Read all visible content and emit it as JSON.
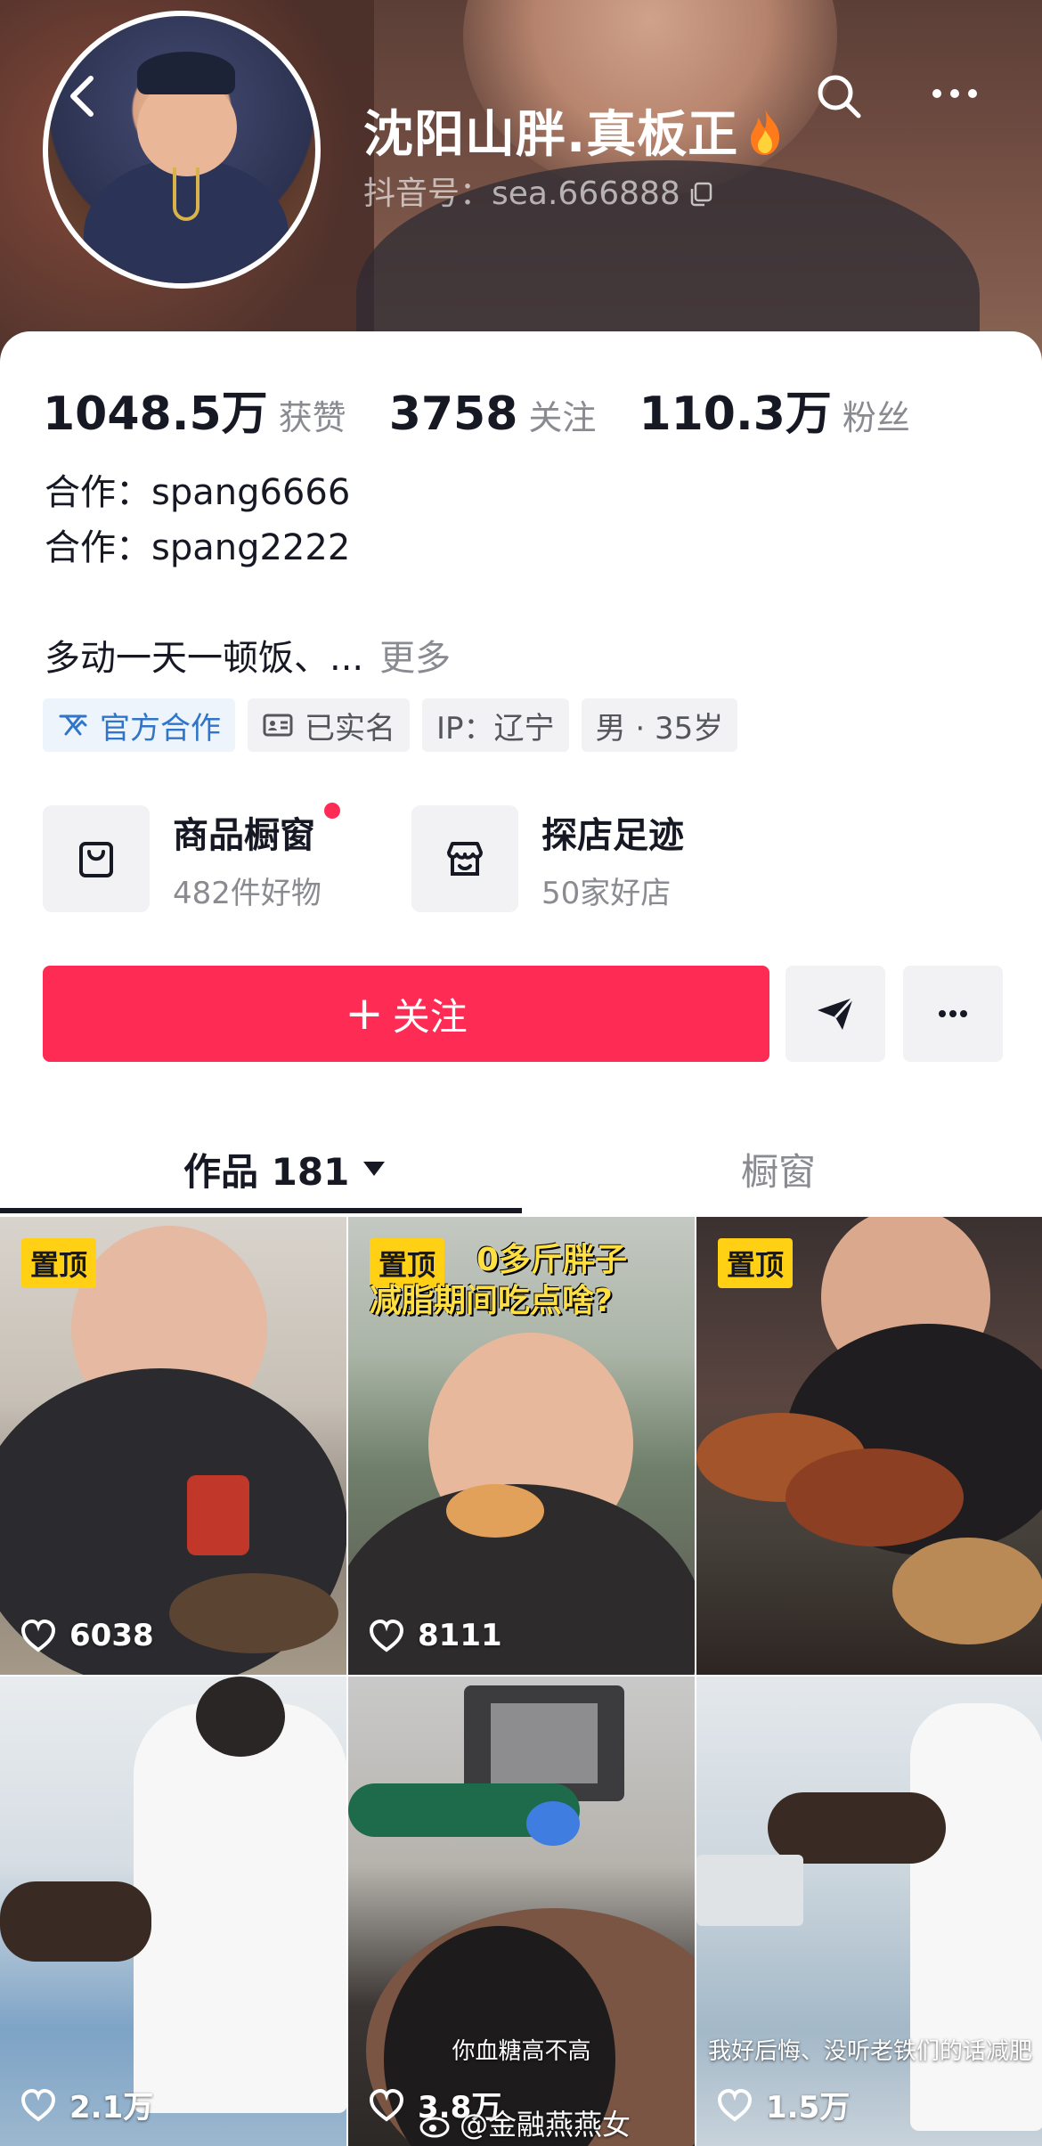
{
  "profile": {
    "name": "沈阳山胖.真板正",
    "handle": "抖音号：sea.666888",
    "stats": [
      {
        "value": "1048.5万",
        "label": "获赞"
      },
      {
        "value": "3758",
        "label": "关注"
      },
      {
        "value": "110.3万",
        "label": "粉丝"
      }
    ],
    "cooperation": [
      "合作：spang6666",
      "合作：spang2222"
    ],
    "bio": "多动一天一顿饭、...",
    "bio_more": "更多",
    "tags": [
      "官方合作",
      "已实名",
      "IP：辽宁",
      "男 · 35岁"
    ]
  },
  "shop": {
    "title": "商品橱窗",
    "subtitle": "482件好物"
  },
  "visits": {
    "title": "探店足迹",
    "subtitle": "50家好店"
  },
  "actions": {
    "follow": "关注"
  },
  "tabs": {
    "works": "作品 181",
    "showcase": "橱窗"
  },
  "videos": [
    {
      "pinned": "置顶",
      "likes": "6038"
    },
    {
      "pinned": "置顶",
      "likes": "8111",
      "overlay_line1": "0多斤胖子",
      "overlay_line2": "减脂期间吃点啥?"
    },
    {
      "pinned": "置顶"
    },
    {
      "likes": "2.1万"
    },
    {
      "likes": "3.8万",
      "caption": "你血糖高不高"
    },
    {
      "likes": "1.5万",
      "caption": "我好后悔、没听老铁们的话减肥"
    }
  ],
  "watermark": "@金融燕燕女",
  "colors": {
    "accent": "#fe2c55",
    "pin": "#ffd014",
    "official": "#2f76c9"
  },
  "icons": [
    "back-arrow-icon",
    "search-icon",
    "more-dots-icon",
    "fire-icon",
    "copy-icon",
    "official-badge-icon",
    "id-card-icon",
    "shopping-bag-icon",
    "store-icon",
    "send-icon",
    "heart-icon"
  ]
}
